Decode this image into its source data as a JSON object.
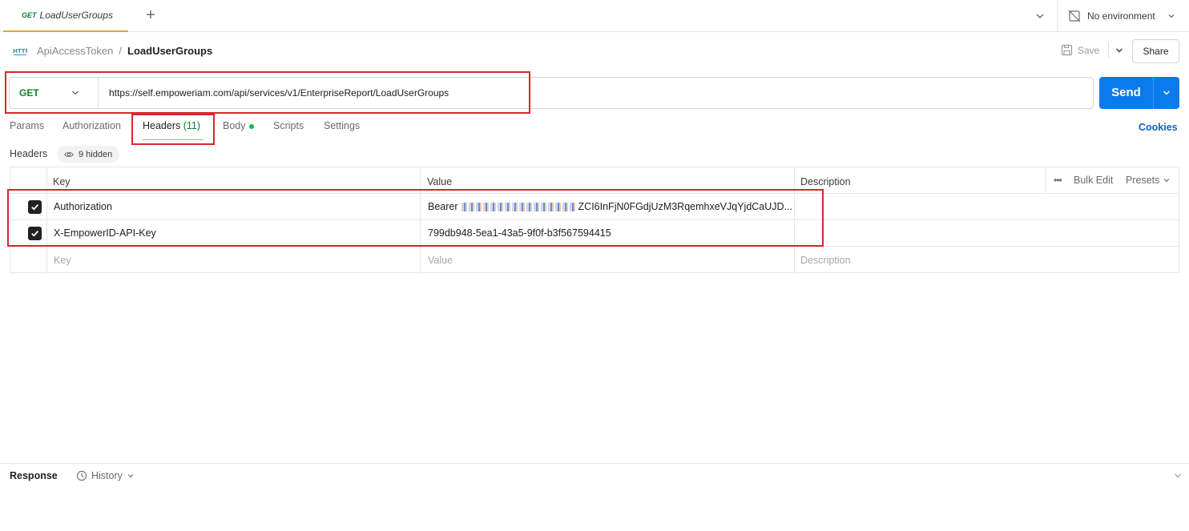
{
  "tab": {
    "method": "GET",
    "title": "LoadUserGroups"
  },
  "environment": {
    "label": "No environment"
  },
  "breadcrumb": {
    "parent": "ApiAccessToken",
    "separator": "/",
    "current": "LoadUserGroups"
  },
  "toolbar": {
    "save_label": "Save",
    "share_label": "Share"
  },
  "request": {
    "method": "GET",
    "url": "https://self.empoweriam.com/api/services/v1/EnterpriseReport/LoadUserGroups",
    "send_label": "Send"
  },
  "request_tabs": {
    "params": "Params",
    "authorization": "Authorization",
    "headers": "Headers",
    "headers_count": "(11)",
    "body": "Body",
    "scripts": "Scripts",
    "settings": "Settings",
    "cookies": "Cookies"
  },
  "headers_section": {
    "label": "Headers",
    "hidden": "9 hidden"
  },
  "table": {
    "columns": {
      "key": "Key",
      "value": "Value",
      "description": "Description"
    },
    "actions": {
      "bulk_edit": "Bulk Edit",
      "presets": "Presets"
    },
    "rows": [
      {
        "checked": true,
        "key": "Authorization",
        "value_prefix": "Bearer",
        "value": "ZCI6InFjN0FGdjUzM3RqemhxeVJqYjdCaUJD...",
        "description": ""
      },
      {
        "checked": true,
        "key": "X-EmpowerID-API-Key",
        "value": "799db948-5ea1-43a5-9f0f-b3f567594415",
        "description": ""
      }
    ],
    "placeholders": {
      "key": "Key",
      "value": "Value",
      "description": "Description"
    }
  },
  "response": {
    "label": "Response",
    "history": "History"
  },
  "colors": {
    "accent": "#097bed",
    "method_get": "#0a7f2e",
    "highlight": "#d9252f",
    "tab_underline": "#d9a441",
    "link": "#0b65c2"
  }
}
